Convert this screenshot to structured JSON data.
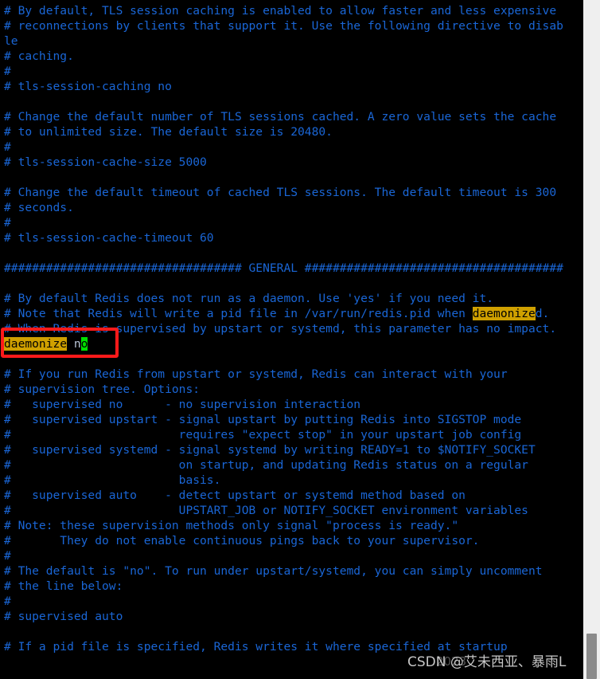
{
  "app": {
    "type": "terminal-text-editor",
    "file_kind": "redis-config",
    "background_color": "#000000",
    "comment_color": "#1a66d6",
    "code_color": "#b9c4d6",
    "search_highlight_color": "#cfa000",
    "cursor_color": "#00e000",
    "annotation_color": "#ff1a1a"
  },
  "editor": {
    "lines": [
      {
        "id": 0,
        "segments": [
          {
            "text": "# By default, TLS session caching is enabled to allow faster and less expensive",
            "style": "comment"
          }
        ]
      },
      {
        "id": 1,
        "segments": [
          {
            "text": "# reconnections by clients that support it. Use the following directive to disab",
            "style": "comment"
          }
        ]
      },
      {
        "id": 2,
        "segments": [
          {
            "text": "le",
            "style": "comment"
          }
        ]
      },
      {
        "id": 3,
        "segments": [
          {
            "text": "# caching.",
            "style": "comment"
          }
        ]
      },
      {
        "id": 4,
        "segments": [
          {
            "text": "#",
            "style": "comment"
          }
        ]
      },
      {
        "id": 5,
        "segments": [
          {
            "text": "# tls-session-caching no",
            "style": "comment"
          }
        ]
      },
      {
        "id": 6,
        "segments": [
          {
            "text": "",
            "style": "comment"
          }
        ]
      },
      {
        "id": 7,
        "segments": [
          {
            "text": "# Change the default number of TLS sessions cached. A zero value sets the cache",
            "style": "comment"
          }
        ]
      },
      {
        "id": 8,
        "segments": [
          {
            "text": "# to unlimited size. The default size is 20480.",
            "style": "comment"
          }
        ]
      },
      {
        "id": 9,
        "segments": [
          {
            "text": "#",
            "style": "comment"
          }
        ]
      },
      {
        "id": 10,
        "segments": [
          {
            "text": "# tls-session-cache-size 5000",
            "style": "comment"
          }
        ]
      },
      {
        "id": 11,
        "segments": [
          {
            "text": "",
            "style": "comment"
          }
        ]
      },
      {
        "id": 12,
        "segments": [
          {
            "text": "# Change the default timeout of cached TLS sessions. The default timeout is 300",
            "style": "comment"
          }
        ]
      },
      {
        "id": 13,
        "segments": [
          {
            "text": "# seconds.",
            "style": "comment"
          }
        ]
      },
      {
        "id": 14,
        "segments": [
          {
            "text": "#",
            "style": "comment"
          }
        ]
      },
      {
        "id": 15,
        "segments": [
          {
            "text": "# tls-session-cache-timeout 60",
            "style": "comment"
          }
        ]
      },
      {
        "id": 16,
        "segments": [
          {
            "text": "",
            "style": "comment"
          }
        ]
      },
      {
        "id": 17,
        "segments": [
          {
            "text": "################################## GENERAL #####################################",
            "style": "comment"
          }
        ]
      },
      {
        "id": 18,
        "segments": [
          {
            "text": "",
            "style": "comment"
          }
        ]
      },
      {
        "id": 19,
        "segments": [
          {
            "text": "# By default Redis does not run as a daemon. Use 'yes' if you need it.",
            "style": "comment"
          }
        ]
      },
      {
        "id": 20,
        "segments": [
          {
            "text": "# Note that Redis will write a pid file in /var/run/redis.pid when ",
            "style": "comment"
          },
          {
            "text": "daemonize",
            "style": "hl"
          },
          {
            "text": "d.",
            "style": "comment"
          }
        ]
      },
      {
        "id": 21,
        "segments": [
          {
            "text": "# When Redis is supervised by upstart or systemd, this parameter has no impact.",
            "style": "comment"
          }
        ]
      },
      {
        "id": 22,
        "segments": [
          {
            "text": "daemonize",
            "style": "hl"
          },
          {
            "text": " n",
            "style": "code"
          },
          {
            "text": "o",
            "style": "cursor"
          }
        ]
      },
      {
        "id": 23,
        "segments": [
          {
            "text": "",
            "style": "comment"
          }
        ]
      },
      {
        "id": 24,
        "segments": [
          {
            "text": "# If you run Redis from upstart or systemd, Redis can interact with your",
            "style": "comment"
          }
        ]
      },
      {
        "id": 25,
        "segments": [
          {
            "text": "# supervision tree. Options:",
            "style": "comment"
          }
        ]
      },
      {
        "id": 26,
        "segments": [
          {
            "text": "#   supervised no      - no supervision interaction",
            "style": "comment"
          }
        ]
      },
      {
        "id": 27,
        "segments": [
          {
            "text": "#   supervised upstart - signal upstart by putting Redis into SIGSTOP mode",
            "style": "comment"
          }
        ]
      },
      {
        "id": 28,
        "segments": [
          {
            "text": "#                        requires \"expect stop\" in your upstart job config",
            "style": "comment"
          }
        ]
      },
      {
        "id": 29,
        "segments": [
          {
            "text": "#   supervised systemd - signal systemd by writing READY=1 to $NOTIFY_SOCKET",
            "style": "comment"
          }
        ]
      },
      {
        "id": 30,
        "segments": [
          {
            "text": "#                        on startup, and updating Redis status on a regular",
            "style": "comment"
          }
        ]
      },
      {
        "id": 31,
        "segments": [
          {
            "text": "#                        basis.",
            "style": "comment"
          }
        ]
      },
      {
        "id": 32,
        "segments": [
          {
            "text": "#   supervised auto    - detect upstart or systemd method based on",
            "style": "comment"
          }
        ]
      },
      {
        "id": 33,
        "segments": [
          {
            "text": "#                        UPSTART_JOB or NOTIFY_SOCKET environment variables",
            "style": "comment"
          }
        ]
      },
      {
        "id": 34,
        "segments": [
          {
            "text": "# Note: these supervision methods only signal \"process is ready.\"",
            "style": "comment"
          }
        ]
      },
      {
        "id": 35,
        "segments": [
          {
            "text": "#       They do not enable continuous pings back to your supervisor.",
            "style": "comment"
          }
        ]
      },
      {
        "id": 36,
        "segments": [
          {
            "text": "#",
            "style": "comment"
          }
        ]
      },
      {
        "id": 37,
        "segments": [
          {
            "text": "# The default is \"no\". To run under upstart/systemd, you can simply uncomment",
            "style": "comment"
          }
        ]
      },
      {
        "id": 38,
        "segments": [
          {
            "text": "# the line below:",
            "style": "comment"
          }
        ]
      },
      {
        "id": 39,
        "segments": [
          {
            "text": "#",
            "style": "comment"
          }
        ]
      },
      {
        "id": 40,
        "segments": [
          {
            "text": "# supervised auto",
            "style": "comment"
          }
        ]
      },
      {
        "id": 41,
        "segments": [
          {
            "text": "",
            "style": "comment"
          }
        ]
      },
      {
        "id": 42,
        "segments": [
          {
            "text": "# If a pid file is specified, Redis writes it where specified at startup",
            "style": "comment"
          }
        ]
      }
    ]
  },
  "annotation": {
    "label": "daemonize-directive-callout",
    "target_text": "daemonize no",
    "color": "#ff1a1a"
  },
  "scrollbar": {
    "track_color": "#efefef",
    "thumb_color": "#8b8b8b",
    "orientation": "vertical"
  },
  "watermark": {
    "text": "CSDN @艾未西亚、暴雨L",
    "ghost_text": "2023"
  }
}
